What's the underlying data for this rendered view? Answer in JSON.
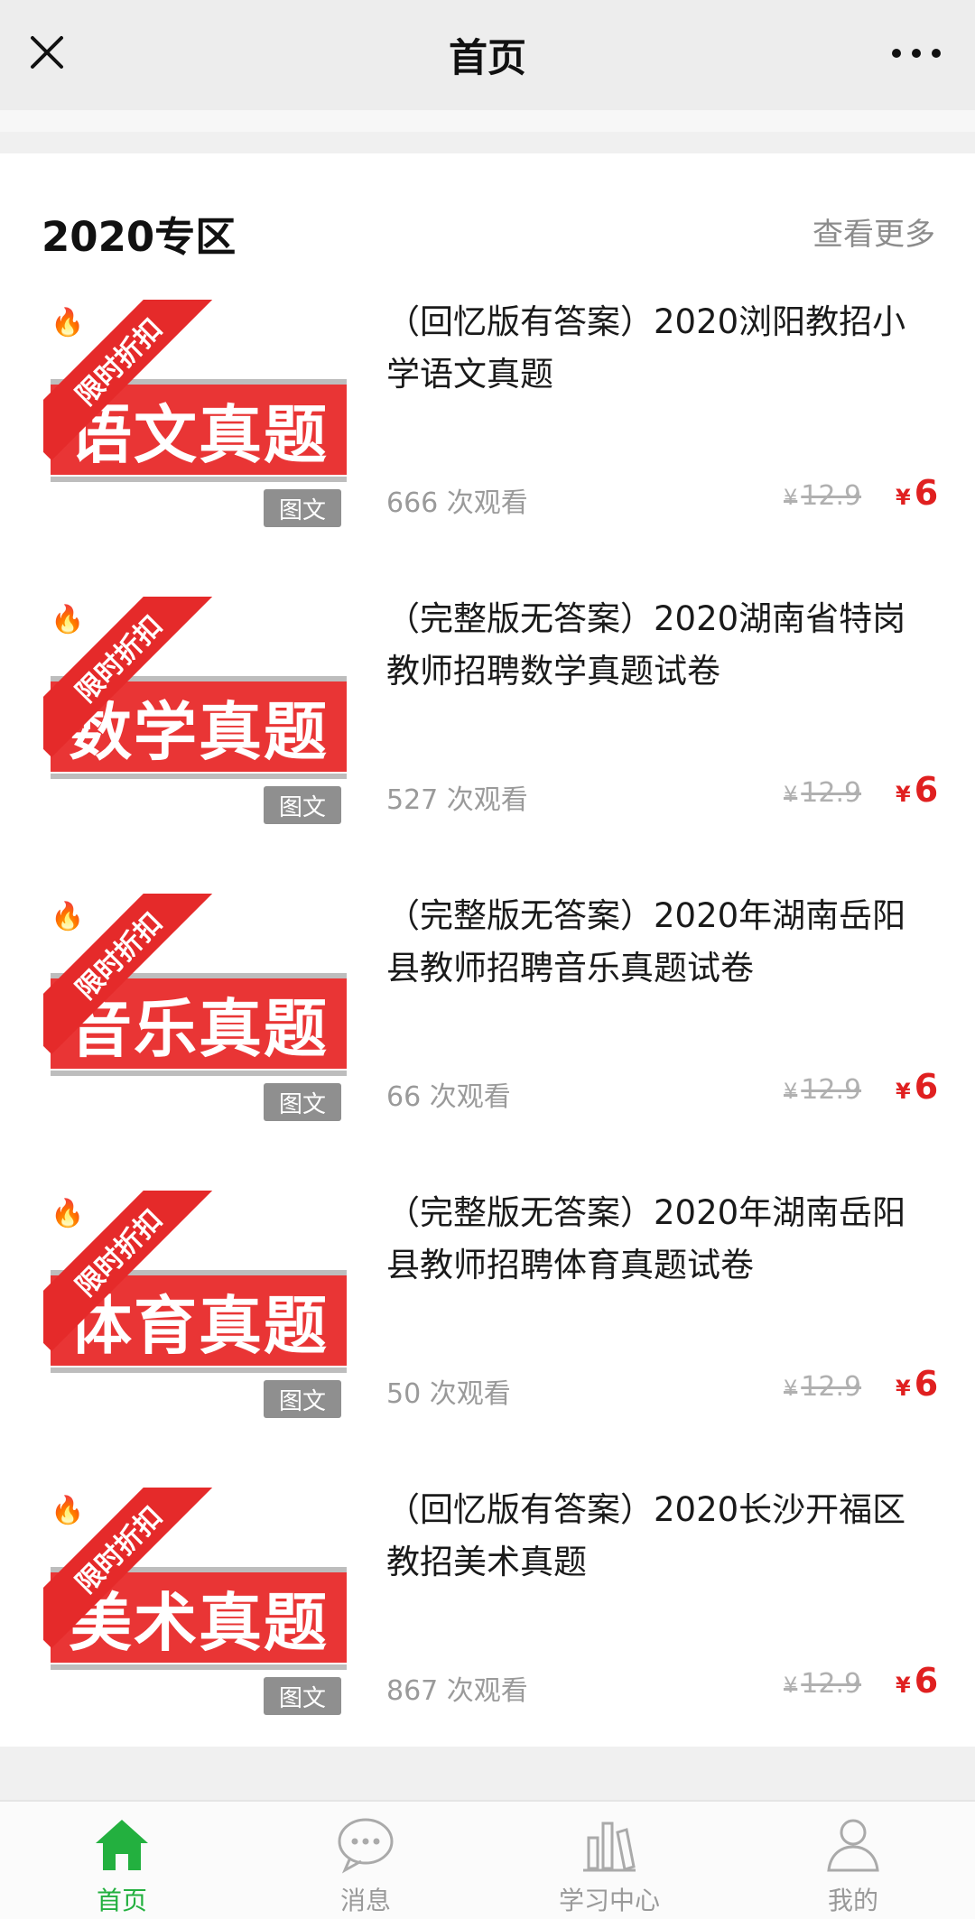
{
  "header": {
    "title": "首页"
  },
  "section": {
    "title": "2020专区",
    "more": "查看更多"
  },
  "items": [
    {
      "title": "（回忆版有答案）2020浏阳教招小学语文真题",
      "cover_text": "语文真题",
      "ribbon": "限时折扣",
      "tag": "图文",
      "views": "666 次观看",
      "old_price": "12.9",
      "price": "6",
      "currency": "¥"
    },
    {
      "title": "（完整版无答案）2020湖南省特岗教师招聘数学真题试卷",
      "cover_text": "数学真题",
      "ribbon": "限时折扣",
      "tag": "图文",
      "views": "527 次观看",
      "old_price": "12.9",
      "price": "6",
      "currency": "¥"
    },
    {
      "title": "（完整版无答案）2020年湖南岳阳县教师招聘音乐真题试卷",
      "cover_text": "音乐真题",
      "ribbon": "限时折扣",
      "tag": "图文",
      "views": "66 次观看",
      "old_price": "12.9",
      "price": "6",
      "currency": "¥"
    },
    {
      "title": "（完整版无答案）2020年湖南岳阳县教师招聘体育真题试卷",
      "cover_text": "体育真题",
      "ribbon": "限时折扣",
      "tag": "图文",
      "views": "50 次观看",
      "old_price": "12.9",
      "price": "6",
      "currency": "¥"
    },
    {
      "title": "（回忆版有答案）2020长沙开福区教招美术真题",
      "cover_text": "美术真题",
      "ribbon": "限时折扣",
      "tag": "图文",
      "views": "867 次观看",
      "old_price": "12.9",
      "price": "6",
      "currency": "¥"
    }
  ],
  "tabs": [
    {
      "label": "首页",
      "icon": "home-icon",
      "active": true
    },
    {
      "label": "消息",
      "icon": "chat-icon",
      "active": false
    },
    {
      "label": "学习中心",
      "icon": "books-icon",
      "active": false
    },
    {
      "label": "我的",
      "icon": "user-icon",
      "active": false
    }
  ],
  "colors": {
    "accent": "#23b03f",
    "price": "#e02020",
    "cover": "#e93535"
  }
}
